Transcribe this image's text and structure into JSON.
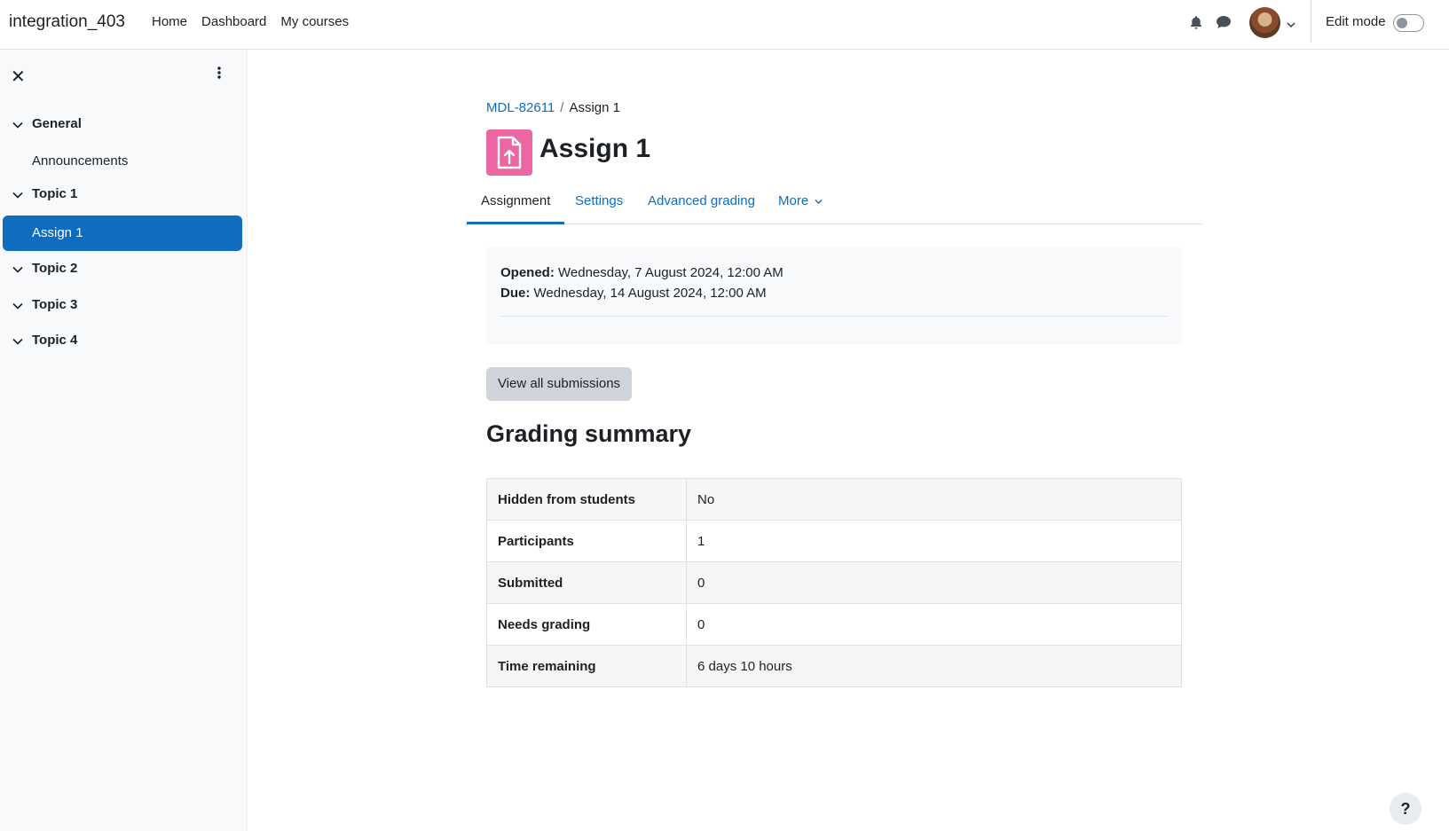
{
  "navbar": {
    "site_name": "integration_403",
    "links": [
      "Home",
      "Dashboard",
      "My courses"
    ],
    "edit_mode_label": "Edit mode",
    "edit_mode_on": false
  },
  "sidebar": {
    "sections": [
      {
        "title": "General",
        "activities": [
          "Announcements"
        ]
      },
      {
        "title": "Topic 1",
        "activities": [
          "Assign 1"
        ]
      },
      {
        "title": "Topic 2",
        "activities": []
      },
      {
        "title": "Topic 3",
        "activities": []
      },
      {
        "title": "Topic 4",
        "activities": []
      }
    ],
    "active_activity": "Assign 1"
  },
  "breadcrumb": {
    "course": "MDL-82611",
    "current": "Assign 1"
  },
  "page": {
    "title": "Assign 1",
    "icon_color": "#eb66a2"
  },
  "tabs": [
    "Assignment",
    "Settings",
    "Advanced grading",
    "More"
  ],
  "dates": {
    "opened_label": "Opened:",
    "opened_value": "Wednesday, 7 August 2024, 12:00 AM",
    "due_label": "Due:",
    "due_value": "Wednesday, 14 August 2024, 12:00 AM"
  },
  "view_submissions_label": "View all submissions",
  "grading_summary": {
    "heading": "Grading summary",
    "rows": [
      {
        "label": "Hidden from students",
        "value": "No"
      },
      {
        "label": "Participants",
        "value": "1"
      },
      {
        "label": "Submitted",
        "value": "0"
      },
      {
        "label": "Needs grading",
        "value": "0"
      },
      {
        "label": "Time remaining",
        "value": "6 days 10 hours"
      }
    ]
  },
  "help_label": "?",
  "colors": {
    "primary": "#0f6cbf",
    "assign_icon": "#eb66a2"
  }
}
